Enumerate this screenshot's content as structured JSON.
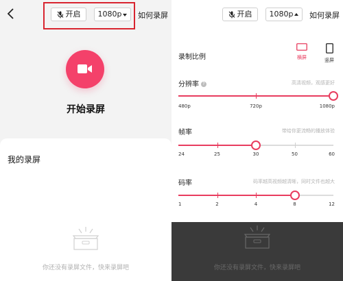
{
  "left": {
    "mic_label": "开启",
    "resolution_label": "1080p",
    "help_label": "如何录屏",
    "start_label": "开始录屏",
    "my_recordings_title": "我的录屏",
    "empty_text": "你还没有录屏文件，快来录屏吧",
    "highlight_color": "#d8242f"
  },
  "right": {
    "mic_label": "开启",
    "resolution_label": "1080p",
    "help_label": "如何录屏",
    "aspect": {
      "label": "录制比例",
      "landscape_label": "横屏",
      "portrait_label": "竖屏",
      "selected": "横屏"
    },
    "resolution": {
      "label": "分辨率",
      "hint": "高清视频，观感更好",
      "ticks": [
        "480p",
        "720p",
        "1080p"
      ],
      "selected_index": 2
    },
    "framerate": {
      "label": "帧率",
      "hint": "带给你更流畅的播放体验",
      "ticks": [
        "24",
        "25",
        "30",
        "50",
        "60"
      ],
      "selected_index": 2
    },
    "bitrate": {
      "label": "码率",
      "hint": "码率越高视频越清晰，同时文件也越大",
      "ticks": [
        "1",
        "2",
        "4",
        "8",
        "12"
      ],
      "selected_index": 3
    },
    "empty_text": "你还没有录屏文件，快来录屏吧"
  },
  "colors": {
    "accent": "#e83c5e",
    "record_button": "#f4416a"
  }
}
